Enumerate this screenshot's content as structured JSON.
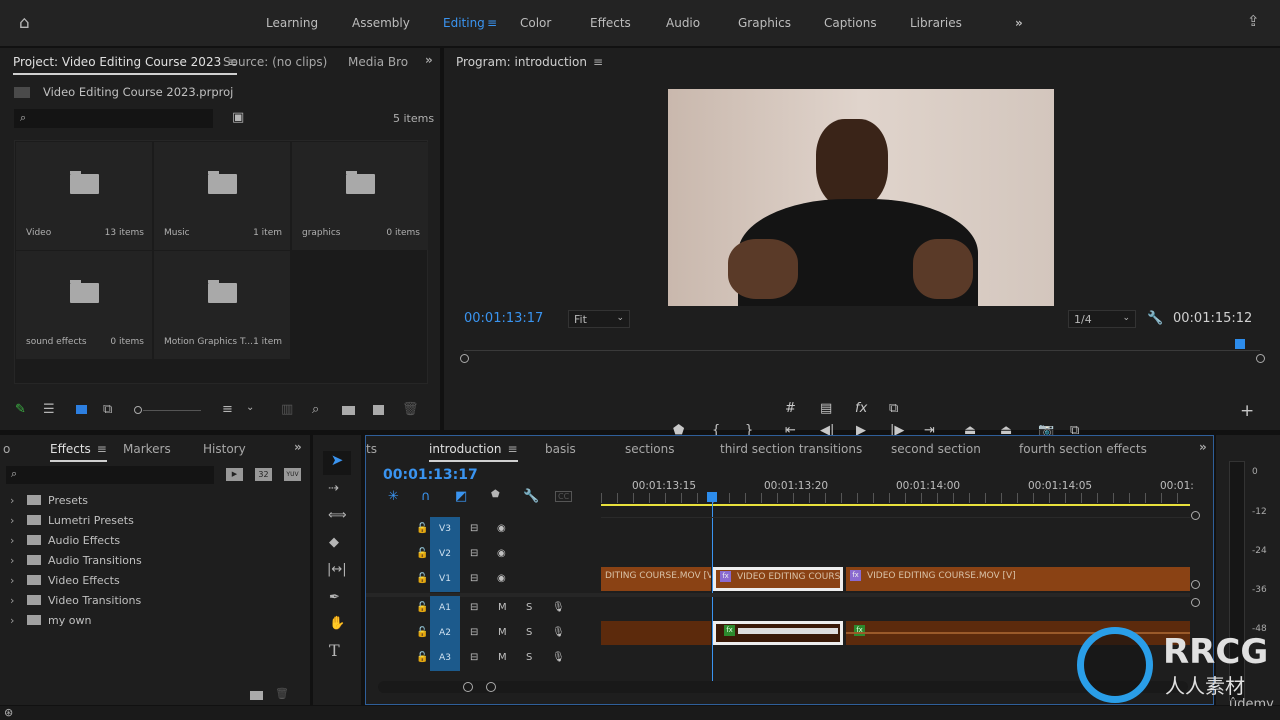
{
  "topbar": {
    "workspaces": [
      "Learning",
      "Assembly",
      "Editing",
      "Color",
      "Effects",
      "Audio",
      "Graphics",
      "Captions",
      "Libraries"
    ],
    "active": "Editing"
  },
  "project": {
    "tabs": [
      "Project: Video Editing Course 2023",
      "Source: (no clips)",
      "Media Bro"
    ],
    "file": "Video Editing Course 2023.prproj",
    "item_count": "5 items",
    "bins": [
      {
        "name": "Video",
        "count": "13 items"
      },
      {
        "name": "Music",
        "count": "1 item"
      },
      {
        "name": "graphics",
        "count": "0 items"
      },
      {
        "name": "sound effects",
        "count": "0 items"
      },
      {
        "name": "Motion Graphics T...",
        "count": "1 item"
      }
    ]
  },
  "program": {
    "title": "Program: introduction",
    "timecode": "00:01:13:17",
    "fit": "Fit",
    "resolution": "1/4",
    "duration": "00:01:15:12"
  },
  "effects": {
    "tabs": [
      "Effects",
      "Markers",
      "History"
    ],
    "partial_tab": "o",
    "badges": [
      "32",
      "YUV"
    ],
    "items": [
      "Presets",
      "Lumetri Presets",
      "Audio Effects",
      "Audio Transitions",
      "Video Effects",
      "Video Transitions",
      "my own"
    ]
  },
  "timeline": {
    "partial_tab": "ts",
    "tabs": [
      "introduction",
      "basis",
      "sections",
      "third section transitions",
      "second section",
      "fourth section effects"
    ],
    "timecode": "00:01:13:17",
    "cc": "CC",
    "ruler": [
      "00:01:13:15",
      "00:01:13:20",
      "00:01:14:00",
      "00:01:14:05",
      "00:01:"
    ],
    "video_tracks": [
      "V3",
      "V2",
      "V1"
    ],
    "audio_tracks": [
      "A1",
      "A2",
      "A3"
    ],
    "mute": "M",
    "solo": "S",
    "clips": {
      "v1_a": "DITING COURSE.MOV [V]",
      "v1_b": "VIDEO EDITING COURS",
      "v1_c": "VIDEO EDITING COURSE.MOV [V]"
    },
    "fx": "fx"
  },
  "meter": {
    "labels": [
      "0",
      "-12",
      "-24",
      "-36",
      "-48"
    ]
  },
  "watermark": {
    "brand": "RRCG",
    "sub": "人人素材",
    "udemy": "ûdemy"
  },
  "colors": {
    "accent": "#2d8ceb",
    "yellow": "#e8e03c",
    "clip": "#8a4214",
    "track": "#1c5a8c"
  }
}
